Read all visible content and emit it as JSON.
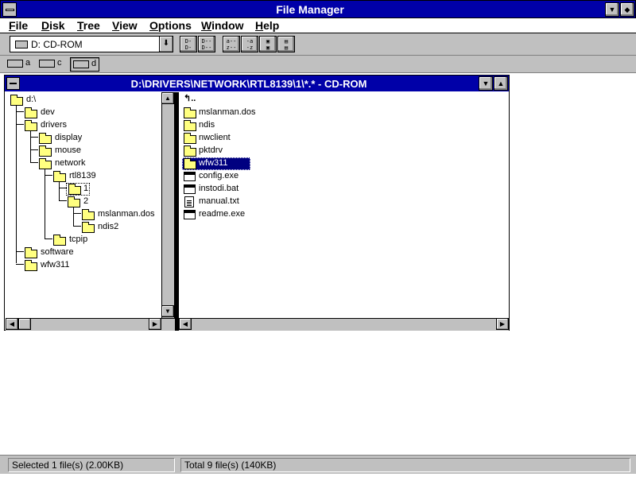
{
  "app": {
    "title": "File Manager"
  },
  "menu": {
    "items": [
      "File",
      "Disk",
      "Tree",
      "View",
      "Options",
      "Window",
      "Help"
    ]
  },
  "toolbar": {
    "drive_selector": "D: CD-ROM",
    "buttons": [
      {
        "icon": "connect-network-drive-icon"
      },
      {
        "icon": "disconnect-network-drive-icon"
      },
      {
        "icon": "sort-by-name-icon"
      },
      {
        "icon": "sort-by-type-icon"
      },
      {
        "icon": "copy-disk-icon"
      },
      {
        "icon": "properties-icon"
      }
    ]
  },
  "drives": [
    {
      "letter": "a",
      "icon": "floppy-drive-icon",
      "selected": false
    },
    {
      "letter": "c",
      "icon": "hard-drive-icon",
      "selected": false
    },
    {
      "letter": "d",
      "icon": "cdrom-drive-icon",
      "selected": true
    }
  ],
  "window": {
    "title": "D:\\DRIVERS\\NETWORK\\RTL8139\\1\\*.* - CD-ROM"
  },
  "tree": [
    {
      "label": "d:\\",
      "level": 0
    },
    {
      "label": "dev",
      "level": 1
    },
    {
      "label": "drivers",
      "level": 1
    },
    {
      "label": "display",
      "level": 2
    },
    {
      "label": "mouse",
      "level": 2
    },
    {
      "label": "network",
      "level": 2
    },
    {
      "label": "rtl8139",
      "level": 3
    },
    {
      "label": "1",
      "level": 4,
      "selected": true
    },
    {
      "label": "2",
      "level": 4
    },
    {
      "label": "mslanman.dos",
      "level": 5
    },
    {
      "label": "ndis2",
      "level": 5
    },
    {
      "label": "tcpip",
      "level": 3
    },
    {
      "label": "software",
      "level": 1
    },
    {
      "label": "wfw311",
      "level": 1
    }
  ],
  "files": [
    {
      "name": "..",
      "type": "up"
    },
    {
      "name": "mslanman.dos",
      "type": "folder"
    },
    {
      "name": "ndis",
      "type": "folder"
    },
    {
      "name": "nwclient",
      "type": "folder"
    },
    {
      "name": "pktdrv",
      "type": "folder"
    },
    {
      "name": "wfw311",
      "type": "folder",
      "selected": true
    },
    {
      "name": "config.exe",
      "type": "exe"
    },
    {
      "name": "instodi.bat",
      "type": "exe"
    },
    {
      "name": "manual.txt",
      "type": "doc"
    },
    {
      "name": "readme.exe",
      "type": "exe"
    }
  ],
  "status": {
    "selected": "Selected 1 file(s) (2.00KB)",
    "total": "Total 9 file(s) (140KB)"
  },
  "colors": {
    "titlebar": "#0000a8",
    "chrome": "#c0c0c0",
    "folder": "#ffff80",
    "selection": "#000080"
  }
}
